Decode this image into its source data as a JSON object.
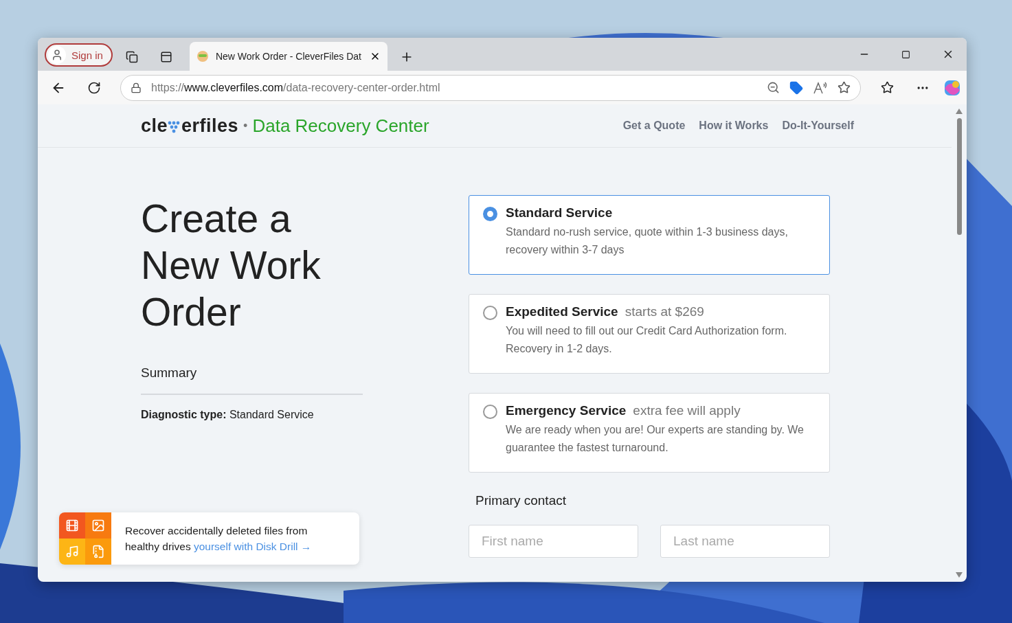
{
  "browser": {
    "sign_in": "Sign in",
    "tab_title": "New Work Order - CleverFiles Dat",
    "url_scheme": "https://",
    "url_host": "www.cleverfiles.com",
    "url_path": "/data-recovery-center-order.html"
  },
  "header": {
    "logo_start": "cle",
    "logo_end": "erfiles",
    "separator": "•",
    "site_title": "Data Recovery Center",
    "nav": [
      "Get a Quote",
      "How it Works",
      "Do-It-Yourself"
    ]
  },
  "page": {
    "heading": "Create a New Work Order",
    "summary_title": "Summary",
    "summary_label": "Diagnostic type:",
    "summary_value": "Standard Service"
  },
  "services": [
    {
      "name": "Standard Service",
      "description": "Standard no-rush service, quote within 1-3 business days, recovery within 3-7 days",
      "selected": true
    },
    {
      "name": "Expedited Service",
      "note": "starts at $269",
      "description": "You will need to fill out our Credit Card Authorization form. Recovery in 1-2 days.",
      "selected": false
    },
    {
      "name": "Emergency Service",
      "note": "extra fee will apply",
      "description": "We are ready when you are! Our experts are standing by. We guarantee the fastest turnaround.",
      "selected": false
    }
  ],
  "contact": {
    "title": "Primary contact",
    "fields": [
      {
        "placeholder": "First name"
      },
      {
        "placeholder": "Last name"
      }
    ]
  },
  "promo": {
    "text": "Recover accidentally deleted files from healthy drives",
    "link": "yourself with Disk Drill →"
  }
}
